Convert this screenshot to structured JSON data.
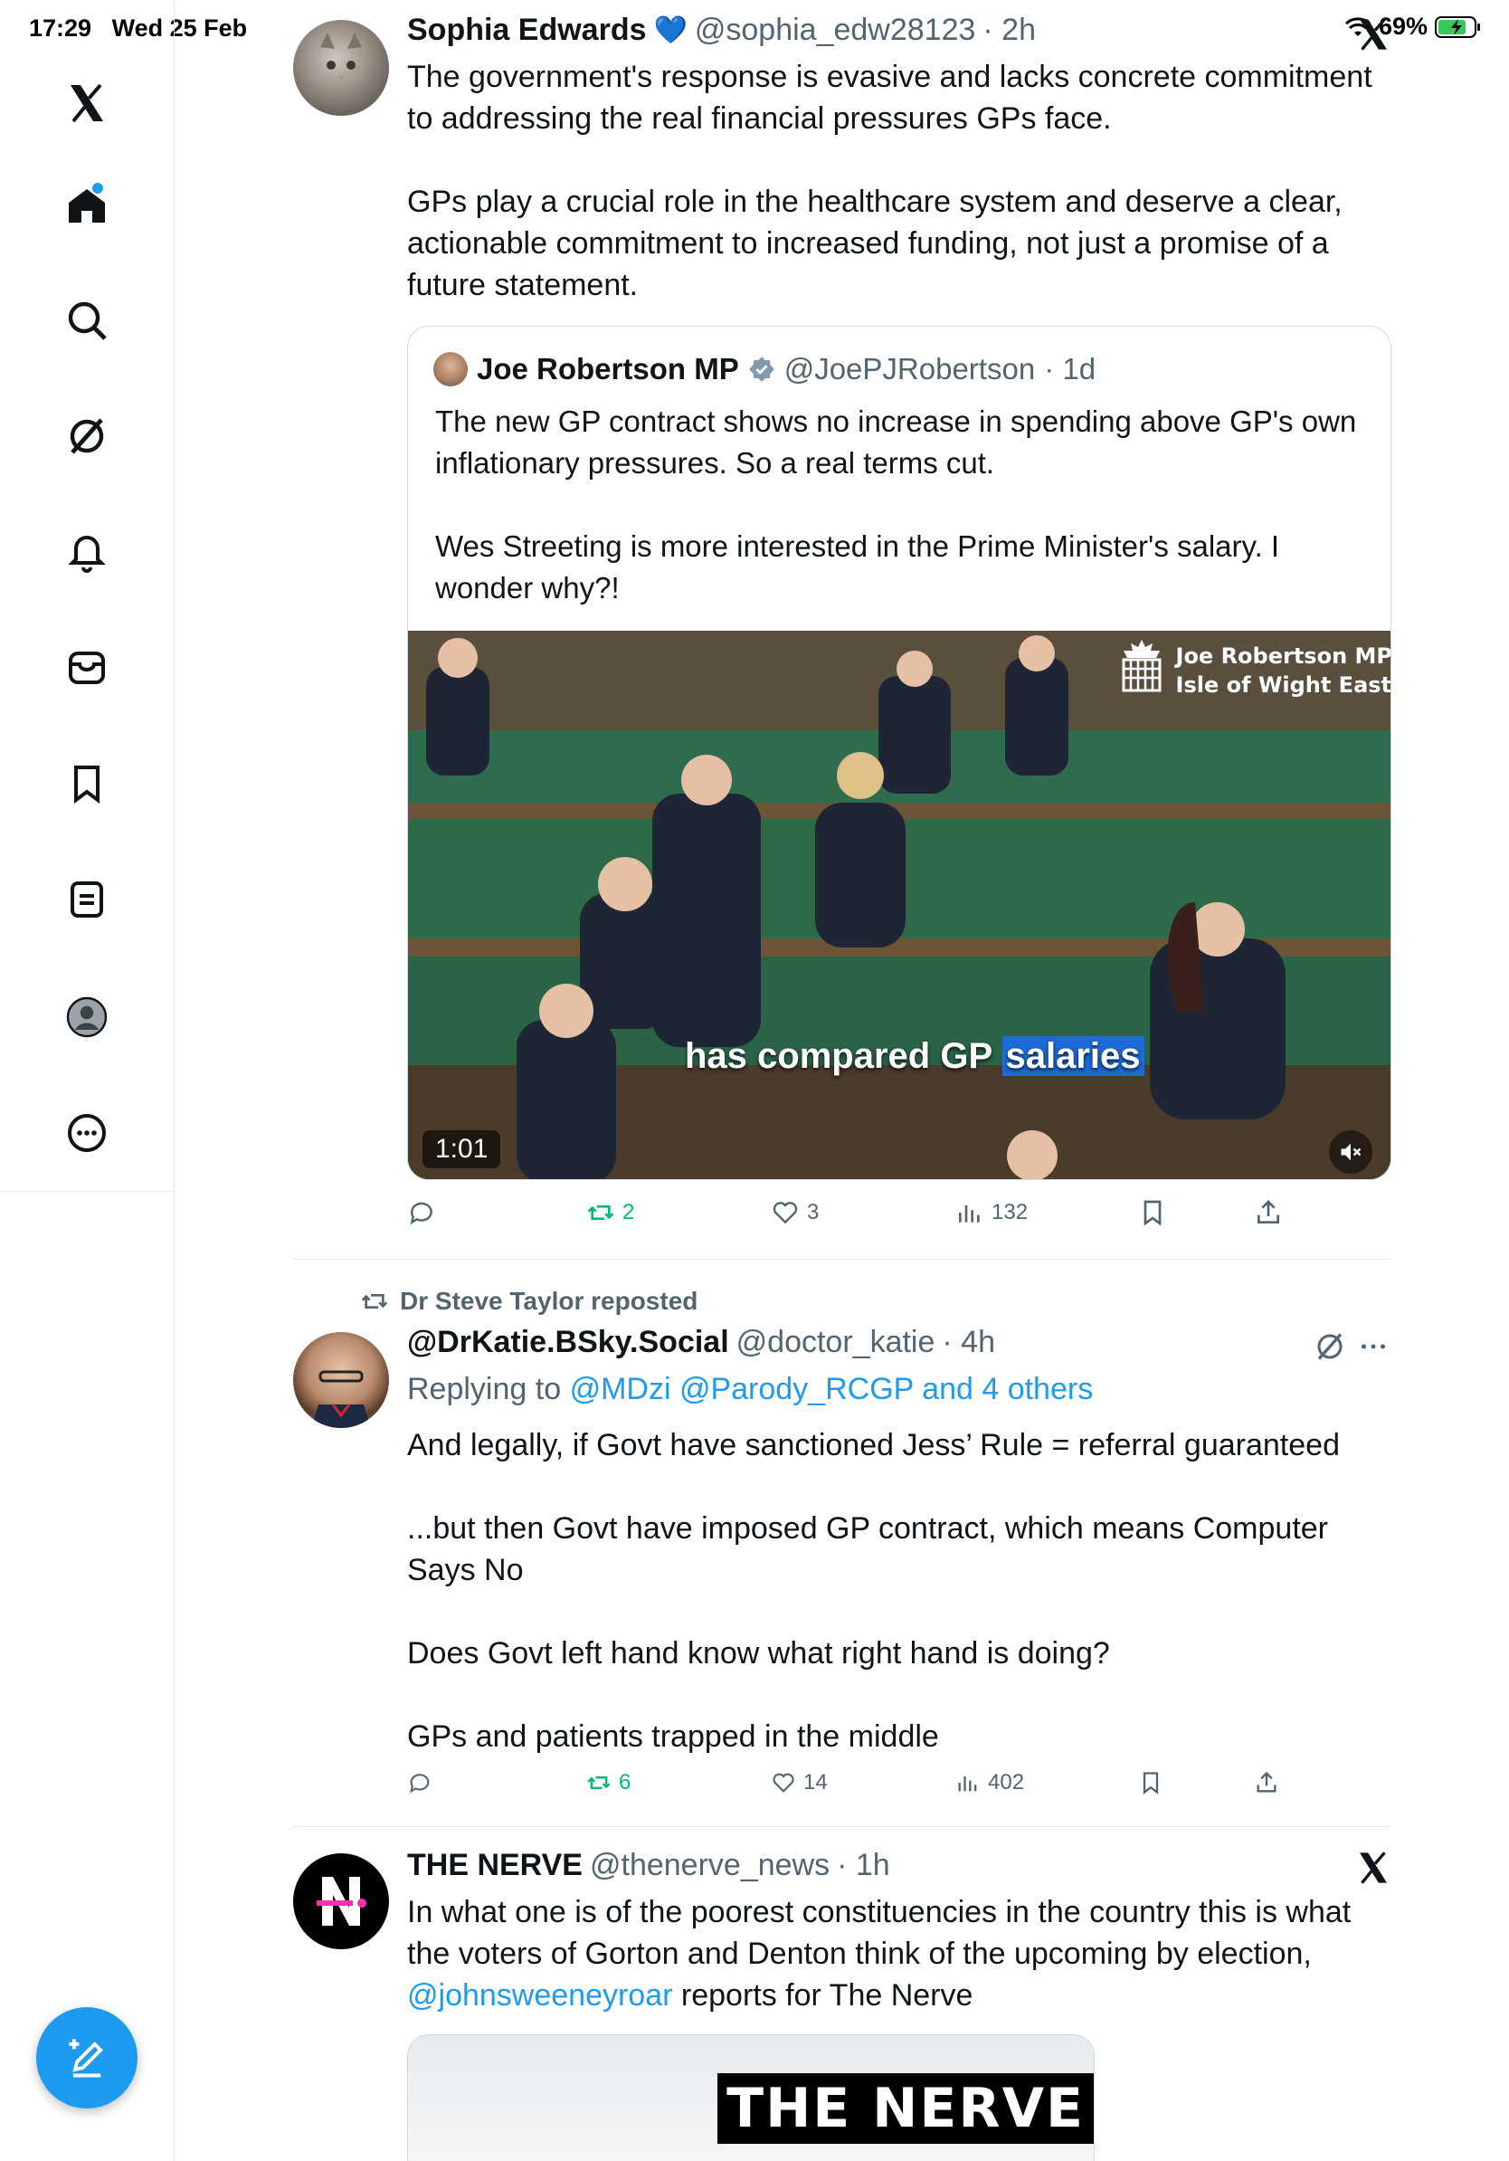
{
  "status_bar": {
    "time": "17:29",
    "date": "Wed 25 Feb",
    "battery": "69%"
  },
  "sidebar": {
    "items": [
      {
        "name": "x-logo-icon"
      },
      {
        "name": "home-icon"
      },
      {
        "name": "search-icon"
      },
      {
        "name": "grok-icon"
      },
      {
        "name": "notifications-icon"
      },
      {
        "name": "messages-icon"
      },
      {
        "name": "bookmarks-icon"
      },
      {
        "name": "lists-icon"
      },
      {
        "name": "profile-icon"
      },
      {
        "name": "more-icon"
      }
    ],
    "compose_icon": "compose-icon"
  },
  "tweet1": {
    "name": "Sophia Edwards",
    "badge": "💙",
    "handle": "@sophia_edw28123",
    "time": "· 2h",
    "body": [
      "The government's response is evasive and lacks concrete commitment to addressing the real financial pressures GPs face.",
      "GPs play a crucial role in the healthcare system and deserve a clear, actionable commitment to increased funding, not just a promise of a future statement."
    ],
    "quote": {
      "name": "Joe Robertson MP",
      "handle": "@JoePJRobertson",
      "time": "· 1d",
      "body": [
        "The new GP contract shows no increase in spending above GP's own inflationary pressures. So a real terms cut.",
        "Wes Streeting is more interested in the Prime Minister's salary. I wonder why?!"
      ],
      "video": {
        "caption_pre": "has compared GP ",
        "caption_hl": "salaries",
        "duration": "1:01",
        "label_line1": "Joe Robertson MP",
        "label_line2": "Isle of Wight East"
      }
    },
    "actions": {
      "replies": "",
      "reposts": "2",
      "likes": "3",
      "views": "132"
    }
  },
  "tweet2": {
    "repost_by": "Dr Steve Taylor reposted",
    "name": "@DrKatie.BSky.Social",
    "handle": "@doctor_katie",
    "time": "· 4h",
    "reply_prefix": "Replying to",
    "reply_targets": "@MDzi @Parody_RCGP and 4 others",
    "body": [
      "And legally, if Govt have sanctioned Jess’ Rule = referral guaranteed",
      "...but then Govt have imposed GP contract, which means Computer Says No",
      "Does Govt left hand know what right hand is doing?",
      "GPs and patients trapped in the middle"
    ],
    "actions": {
      "replies": "",
      "reposts": "6",
      "likes": "14",
      "views": "402"
    }
  },
  "tweet3": {
    "name": "THE NERVE",
    "handle": "@thenerve_news",
    "time": "· 1h",
    "body_part1": "In what one is of the poorest constituencies in the country this is what the voters of Gorton and Denton think of the upcoming by election,",
    "mention": "@johnsweeneyroar",
    "body_part2": "reports for The Nerve",
    "thumb_text": "THE NERVE"
  },
  "colors": {
    "accent": "#1d9bf0",
    "repost_green": "#00ba7c",
    "muted": "#536471"
  }
}
